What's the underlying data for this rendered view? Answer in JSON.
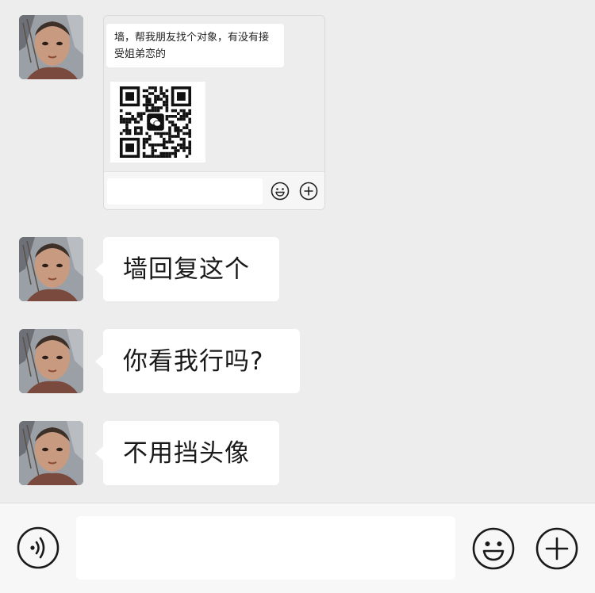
{
  "forwarded_card": {
    "message_text": "墙，帮我朋友找个对象，有没有接受姐弟恋的"
  },
  "messages": [
    {
      "text": "墙回复这个"
    },
    {
      "text": "你看我行吗?"
    },
    {
      "text": "不用挡头像"
    }
  ],
  "input_bar": {
    "voice_icon": "voice-icon",
    "emoji_icon": "emoji-icon",
    "plus_icon": "plus-icon",
    "text": ""
  },
  "colors": {
    "background": "#ededed",
    "bubble": "#ffffff",
    "input_bar": "#f7f7f7"
  }
}
